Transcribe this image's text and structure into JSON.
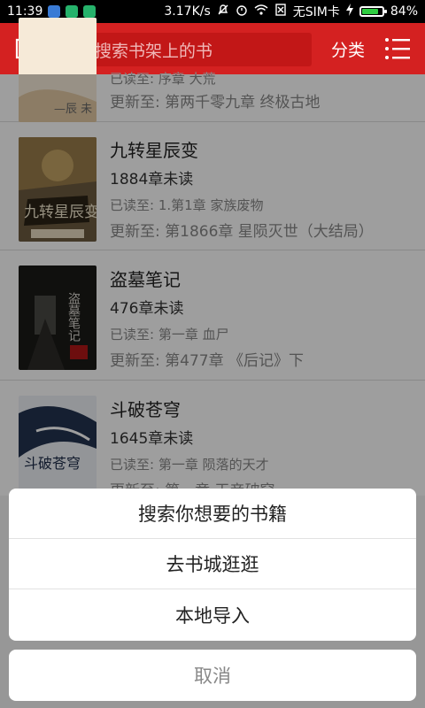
{
  "status_bar": {
    "time": "11:39",
    "speed": "3.17K/s",
    "sim": "无SIM卡",
    "battery": "84%",
    "battery_level": 0.84
  },
  "header": {
    "search_placeholder": "搜索书架上的书",
    "category_label": "分类"
  },
  "books": [
    {
      "partial_read": "已读至: 序章 大荒",
      "updated": "更新至: 第两千零九章 终极古地"
    },
    {
      "title": "九转星辰变",
      "unread": "1884章未读",
      "read_to": "已读至: 1.第1章 家族废物",
      "updated": "更新至: 第1866章 星陨灭世（大结局）"
    },
    {
      "title": "盗墓笔记",
      "unread": "476章未读",
      "read_to": "已读至: 第一章 血尸",
      "updated": "更新至: 第477章 《后记》下"
    },
    {
      "title": "斗破苍穹",
      "unread": "1645章未读",
      "read_to": "已读至: 第一章 陨落的天才",
      "updated": "更新至: 第一章 天帝破穹"
    }
  ],
  "covers": {
    "book2_title": "九转星辰变",
    "book3_text": "盗墓笔记",
    "book4_text": "斗破苍穹"
  },
  "action_sheet": {
    "items": [
      "搜索你想要的书籍",
      "去书城逛逛",
      "本地导入"
    ],
    "cancel": "取消"
  }
}
